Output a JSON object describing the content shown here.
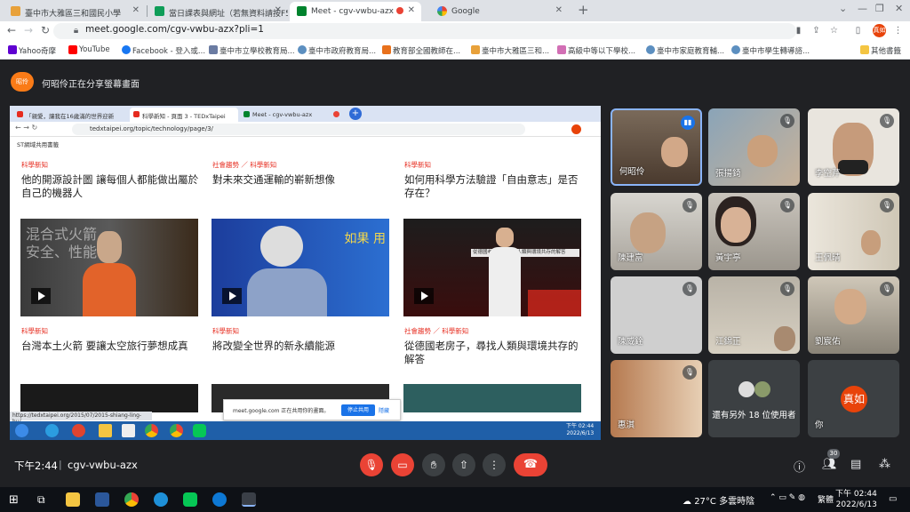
{
  "browser": {
    "tabs": [
      {
        "label": "臺中市大雅區三和國民小學"
      },
      {
        "label": "當日課表與網址（若無資料請按F5"
      },
      {
        "label": "Meet - cgv-vwbu-azx"
      },
      {
        "label": "Google"
      }
    ],
    "url": "meet.google.com/cgv-vwbu-azx?pli=1",
    "profile_initials": "真如",
    "bookmarks": [
      {
        "label": "Yahoo奇摩"
      },
      {
        "label": "YouTube"
      },
      {
        "label": "Facebook - 登入或..."
      },
      {
        "label": "臺中市立學校教育局..."
      },
      {
        "label": "臺中市政府教育局..."
      },
      {
        "label": "教育部全國教師在..."
      },
      {
        "label": "臺中市大雅區三和..."
      },
      {
        "label": "高級中等以下學校..."
      },
      {
        "label": "臺中市家庭教育輔..."
      },
      {
        "label": "臺中市學生轉導諮..."
      },
      {
        "label": "其他書籤"
      }
    ]
  },
  "meet": {
    "presenter_badge": "昭伶",
    "presenting_text": "何昭伶正在分享螢幕畫面",
    "shared_screen": {
      "tabs": [
        {
          "label": "「親愛，讓我在16歲滿的世界迎新"
        },
        {
          "label": "科學新知 - 頁面 3 - TEDxTaipei"
        },
        {
          "label": "Meet - cgv-vwbu-azx"
        }
      ],
      "url": "tedxtaipei.org/topic/technology/page/3/",
      "bookmark": "ST網域共用書籤",
      "articles_top": [
        {
          "category": "科學新知",
          "title": "他的開源設計圖 讓每個人都能做出屬於自己的機器人"
        },
        {
          "category": "社會趨勢 ／ 科學新知",
          "title": "對未來交通運輸的嶄新想像"
        },
        {
          "category": "科學新知",
          "title": "如何用科學方法驗證「自由意志」是否存在？"
        }
      ],
      "articles_bottom": [
        {
          "category": "科學新知",
          "title": "台灣本土火箭 要讓太空旅行夢想成真",
          "overlay": "混合式火箭\n安全、性能"
        },
        {
          "category": "科學新知",
          "title": "將改變全世界的新永續能源",
          "overlay": "如果 用"
        },
        {
          "category": "社會趨勢 ／ 科學新知",
          "title": "從德國老房子，尋找人類與環境共存的解答",
          "overlay": "從德國老房子，尋找人類與環境共存的解答"
        }
      ],
      "status_url": "https://tedxtaipei.org/2015/07/2015-shiang-ling-hu/",
      "share_notice": "meet.google.com 正在共用你的畫面。",
      "stop_share_button": "停止共用",
      "hide_button": "隱藏",
      "taskbar_time": "下午 02:44",
      "taskbar_date": "2022/6/13"
    },
    "participants": [
      {
        "name": "何昭伶"
      },
      {
        "name": "張揚錡"
      },
      {
        "name": "李空芹"
      },
      {
        "name": "陳建富"
      },
      {
        "name": "黃宇亭"
      },
      {
        "name": "王佩晴"
      },
      {
        "name": "陳威銓"
      },
      {
        "name": "江錦正"
      },
      {
        "name": "劉宸佑"
      },
      {
        "name": "惠淇"
      }
    ],
    "others_text": "還有另外 18 位使用者",
    "self_initials": "真如",
    "self_label": "你",
    "time": "下午2:44",
    "meeting_code": "cgv-vwbu-azx",
    "participant_count": "30"
  },
  "taskbar": {
    "weather": "27°C 多雲時陰",
    "ime": "繁體",
    "time": "下午 02:44",
    "date": "2022/6/13"
  },
  "colors": {
    "accent_red": "#ea4335",
    "meet_bg": "#202124",
    "ted_red": "#e62b1e"
  }
}
